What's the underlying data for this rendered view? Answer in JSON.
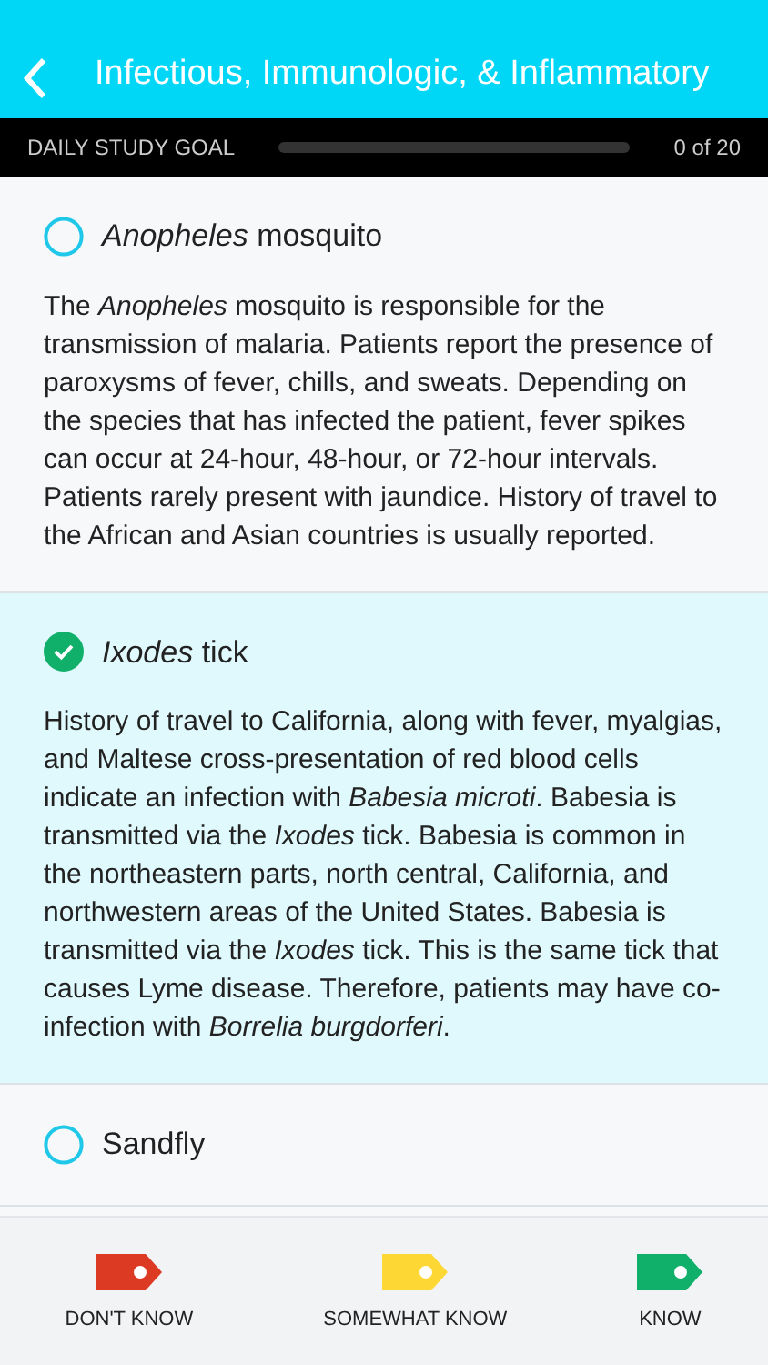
{
  "header": {
    "title": "Infectious, Immunologic, & Inflammatory"
  },
  "goal": {
    "label": "DAILY STUDY GOAL",
    "level": 0,
    "count": "0 of 20"
  },
  "options": [
    {
      "label": "*Anopheles* mosquito",
      "selected": false,
      "explanation": "The *Anopheles* mosquito is responsible for the transmission of malaria. Patients report the presence of paroxysms of fever, chills, and sweats. Depending on the species that has infected the patient, fever spikes can occur at 24-hour, 48-hour, or 72-hour intervals. Patients rarely present with jaundice. History of travel to the African and Asian countries is usually reported."
    },
    {
      "label": "*Ixodes* tick",
      "selected": true,
      "explanation": "History of travel to California, along with fever, myalgias, and Maltese cross-presentation of red blood cells indicate an infection with *Babesia microti*. Babesia is transmitted via the *Ixodes* tick. Babesia is common in the northeastern parts, north central, California, and northwestern areas of the United States. Babesia is transmitted via the *Ixodes* tick. This is the same tick that causes Lyme disease. Therefore, patients may have co-infection with *Borrelia burgdorferi*."
    },
    {
      "label": "Sandfly",
      "selected": false
    }
  ],
  "ratings": [
    {
      "label": "DON'T KNOW",
      "color": "#dc3a22"
    },
    {
      "label": "SOMEWHAT KNOW",
      "color": "#fdd835"
    },
    {
      "label": "KNOW",
      "color": "#10b06b"
    }
  ]
}
